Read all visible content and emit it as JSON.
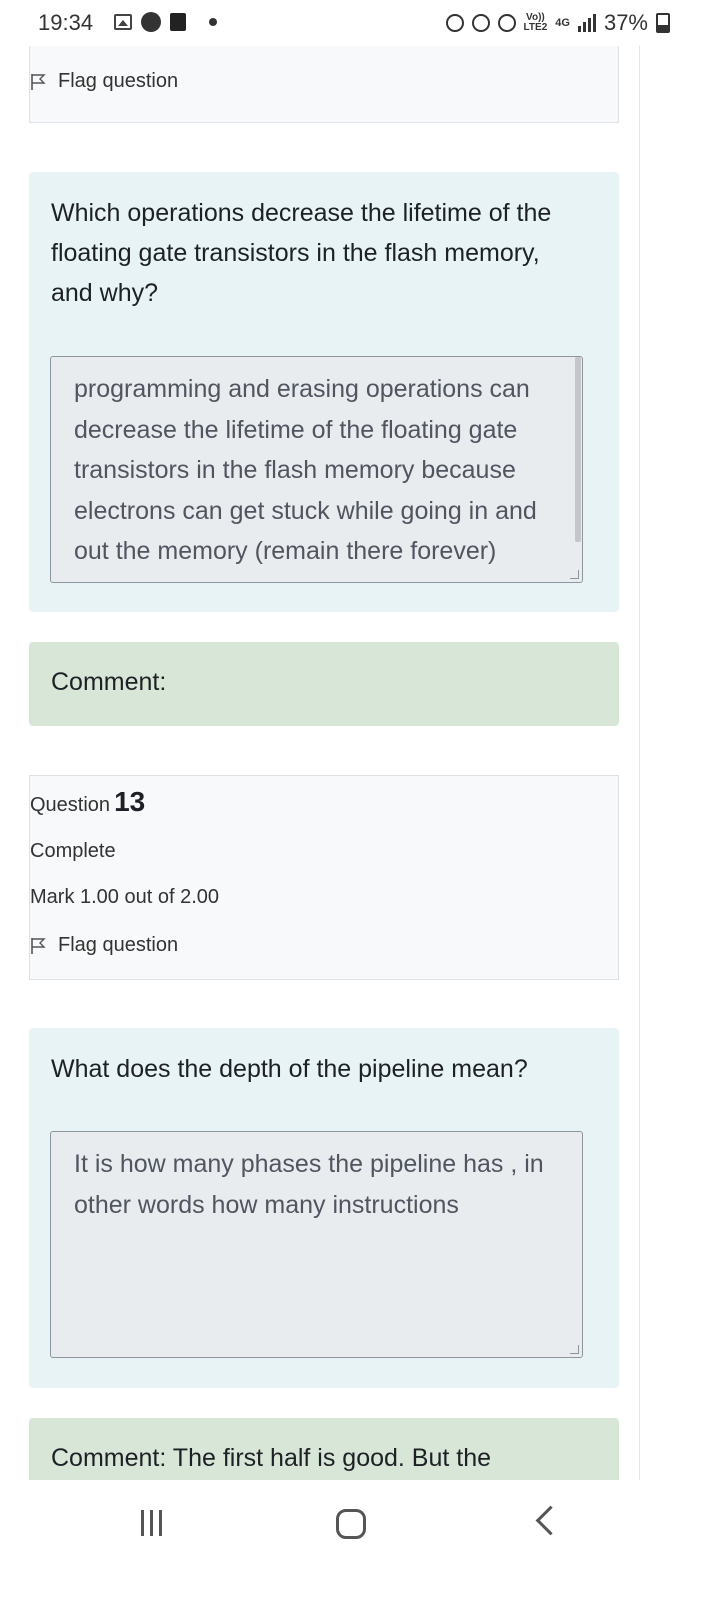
{
  "status_bar": {
    "time": "19:34",
    "volte": "Vo))",
    "lte": "LTE2",
    "network": "4G",
    "battery": "37%"
  },
  "question_12": {
    "flag_label": "Flag question",
    "question_text": "Which operations decrease the lifetime of the floating gate transistors in the flash memory, and why?",
    "answer": "programming and erasing operations can decrease the lifetime of the floating gate transistors in the flash memory because electrons can get stuck while going in and out the memory (remain there forever)",
    "comment": "Comment:"
  },
  "question_13": {
    "question_label": "Question",
    "number": "13",
    "status": "Complete",
    "mark": "Mark 1.00 out of 2.00",
    "flag_label": "Flag question",
    "question_text": "What does the depth of the pipeline mean?",
    "answer": "It is how many phases the pipeline has , in other words how many instructions",
    "comment": "Comment: The first half is good. But the"
  },
  "icons": {
    "flag": "flag-outline-icon",
    "nav_recents": "recents-icon",
    "nav_home": "home-icon",
    "nav_back": "back-chevron-icon"
  }
}
